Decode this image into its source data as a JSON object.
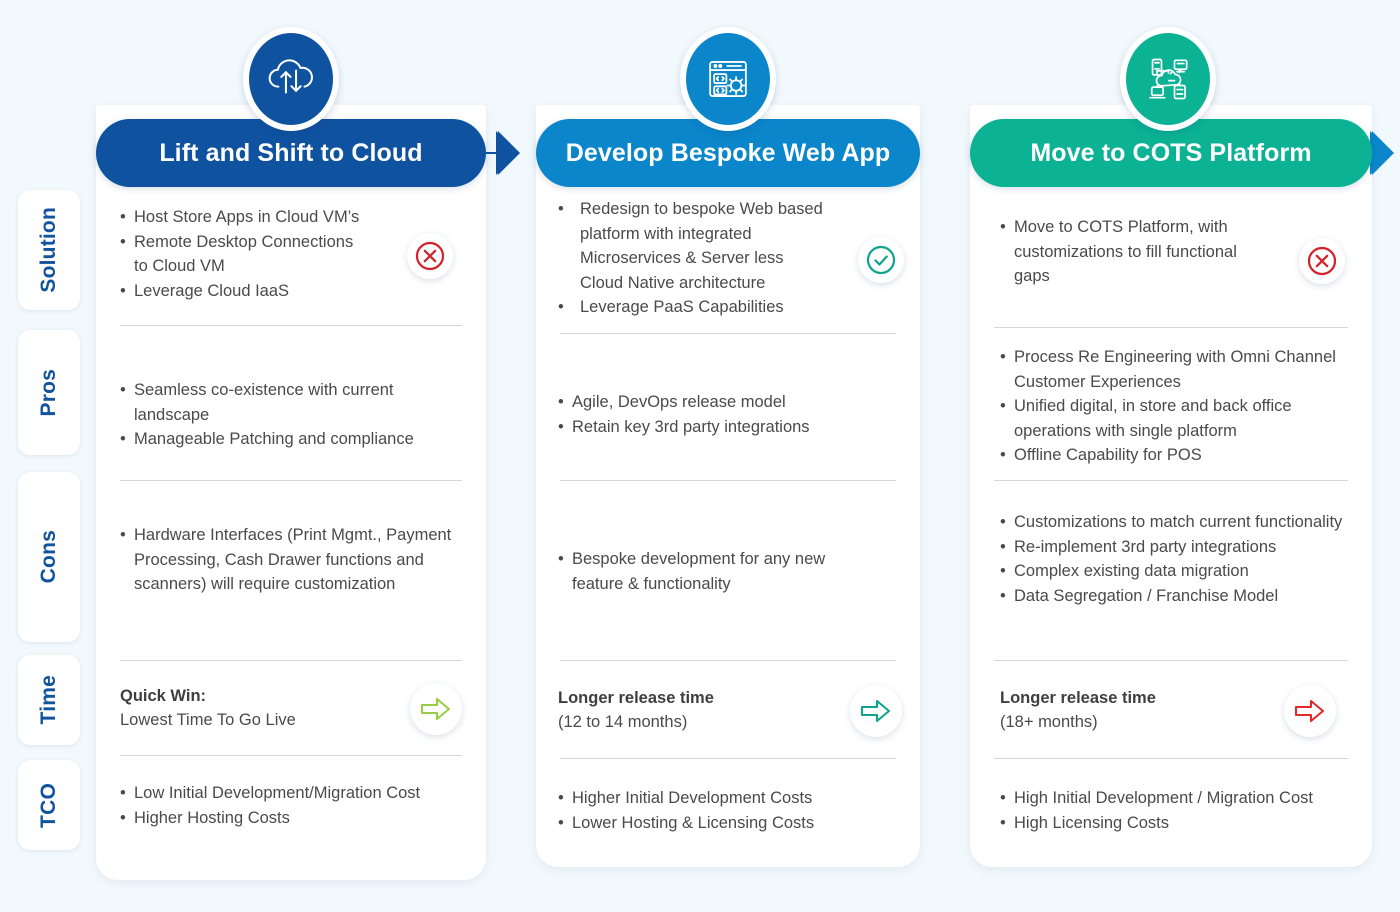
{
  "background_color": "#f2f9fd",
  "rail": {
    "items": [
      {
        "label": "Solution",
        "name": "solution"
      },
      {
        "label": "Pros",
        "name": "pros"
      },
      {
        "label": "Cons",
        "name": "cons"
      },
      {
        "label": "Time",
        "name": "time"
      },
      {
        "label": "TCO",
        "name": "tco"
      }
    ]
  },
  "columns": [
    {
      "title": "Lift and Shift to Cloud",
      "header_color": "#0f52a0",
      "icon": "cloud-upload-download-icon",
      "verdict_badge": "cross-circle-icon",
      "verdict_color": "#d32029",
      "time_badge": "right-arrow-icon",
      "time_badge_color": "#9acd45",
      "solution": [
        "Host Store Apps in Cloud VM’s",
        "Remote Desktop Connections to Cloud VM",
        "Leverage Cloud IaaS"
      ],
      "pros": [
        "Seamless co-existence  with current landscape",
        "Manageable Patching and compliance"
      ],
      "cons": [
        "Hardware Interfaces (Print Mgmt., Payment Processing, Cash Drawer functions and scanners) will require customization"
      ],
      "time_title": "Quick Win:",
      "time_sub": "Lowest Time To Go Live",
      "tco": [
        "Low Initial Development/Migration Cost",
        "Higher Hosting Costs"
      ]
    },
    {
      "title": "Develop Bespoke Web App",
      "header_color": "#0b86cb",
      "icon": "web-app-gear-icon",
      "verdict_badge": "check-circle-icon",
      "verdict_color": "#0fa38c",
      "time_badge": "right-arrow-icon",
      "time_badge_color": "#0fa38c",
      "solution": [
        "Redesign to bespoke Web based platform with integrated Microservices & Server less Cloud Native architecture",
        "Leverage PaaS Capabilities"
      ],
      "pros": [
        "Agile, DevOps release model",
        "Retain key 3rd party integrations"
      ],
      "cons": [
        "Bespoke development for any new feature & functionality"
      ],
      "time_title": "Longer release time",
      "time_sub": "(12 to 14 months)",
      "tco": [
        "Higher Initial Development Costs",
        "Lower Hosting & Licensing Costs"
      ]
    },
    {
      "title": "Move to COTS Platform",
      "header_color": "#0bb394",
      "icon": "cloud-network-devices-icon",
      "verdict_badge": "cross-circle-icon",
      "verdict_color": "#d32029",
      "time_badge": "right-arrow-icon",
      "time_badge_color": "#e02b2b",
      "solution": [
        "Move to COTS Platform, with customizations to fill functional gaps"
      ],
      "pros": [
        "Process Re Engineering with Omni Channel Customer Experiences",
        "Unified digital, in store and back office operations with single platform",
        "Offline Capability for POS"
      ],
      "cons": [
        "Customizations to match current functionality",
        "Re-implement 3rd party integrations",
        "Complex existing data  migration",
        "Data Segregation / Franchise  Model"
      ],
      "time_title": "Longer release time",
      "time_sub": "(18+ months)",
      "tco": [
        "High Initial Development / Migration Cost",
        "High Licensing Costs"
      ]
    }
  ],
  "connectors": [
    {
      "name": "arrow-col1-to-col2",
      "color": "#0f52a0"
    },
    {
      "name": "arrow-col2-to-col3",
      "color": "#0b86cb"
    }
  ]
}
